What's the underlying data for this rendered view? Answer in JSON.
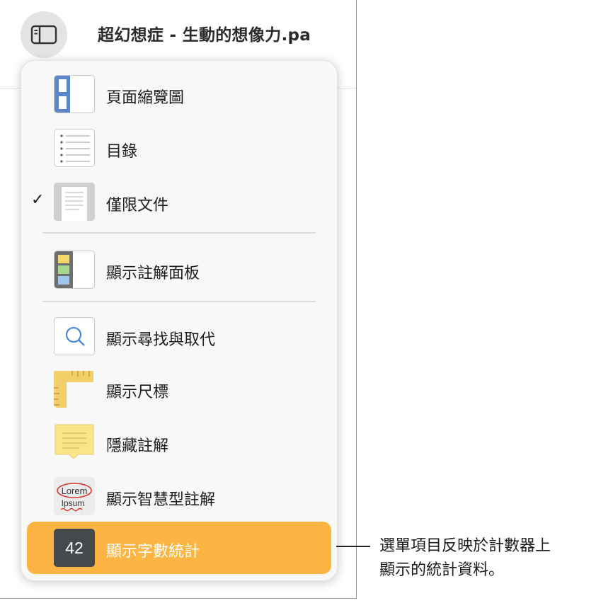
{
  "window": {
    "title": "超幻想症 - 生動的想像力.pa"
  },
  "menu": {
    "items": [
      {
        "label": "頁面縮覽圖",
        "icon": "page-thumbnails-icon",
        "checked": false
      },
      {
        "label": "目錄",
        "icon": "table-of-contents-icon",
        "checked": false
      },
      {
        "label": "僅限文件",
        "icon": "document-only-icon",
        "checked": true
      },
      {
        "label": "顯示註解面板",
        "icon": "comments-pane-icon",
        "checked": false
      },
      {
        "label": "顯示尋找與取代",
        "icon": "search-icon",
        "checked": false
      },
      {
        "label": "顯示尺標",
        "icon": "ruler-icon",
        "checked": false
      },
      {
        "label": "隱藏註解",
        "icon": "comment-icon",
        "checked": false
      },
      {
        "label": "顯示智慧型註解",
        "icon": "smart-annotation-icon",
        "checked": false
      },
      {
        "label": "顯示字數統計",
        "icon": "word-count-icon",
        "checked": false,
        "highlighted": true
      }
    ],
    "check_glyph": "✓",
    "smart_annotation_words": [
      "Lorem",
      "Ipsum"
    ],
    "word_count_value": "42"
  },
  "callout": {
    "line1": "選單項目反映於計數器上",
    "line2": "顯示的統計資料。"
  },
  "colors": {
    "highlight": "#fcb543",
    "toc_border": "#4a8ad6"
  }
}
